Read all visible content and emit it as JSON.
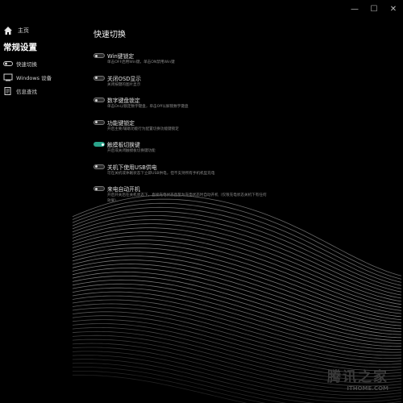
{
  "window": {
    "minimize_glyph": "—",
    "maximize_glyph": "☐",
    "close_glyph": "✕"
  },
  "sidebar": {
    "home_label": "主页",
    "section_title": "常规设置",
    "items": [
      {
        "label": "快速切换",
        "icon": "toggle-icon"
      },
      {
        "label": "Windows 设备",
        "icon": "windows-icon"
      },
      {
        "label": "信息查找",
        "icon": "info-icon"
      }
    ]
  },
  "main": {
    "title": "快速切换",
    "settings": [
      {
        "label": "Win键锁定",
        "desc": "单击OFF启用Win键，单击ON禁用Win键",
        "state": "off"
      },
      {
        "label": "关闭OSD显示",
        "desc": "关闭按键的图片显示",
        "state": "off"
      },
      {
        "label": "数字键盘锁定",
        "desc": "单击On以锁定数字键盘，单击Off以解锁数字键盘",
        "state": "off"
      },
      {
        "label": "功能键锁定",
        "desc": "开启主要/辅助功能行为配置切换功能键锁定",
        "state": "off"
      },
      {
        "label": "触摸板切换键",
        "desc": "开启或关闭触摸板切换键功能",
        "state": "on"
      },
      {
        "label": "关机下使用USB供电",
        "desc": "可在关机或休眠状态下立即USB供电，但不支持所有手机机型充电",
        "state": "off"
      },
      {
        "label": "来电自动开机",
        "desc": "开启开关后在关机状态下，直接充电状态直至为充电状态时自动开机（仅限充电状态关机下有任何效果）",
        "state": "off"
      }
    ]
  },
  "watermark": {
    "main": "腾讯之家",
    "sub": "ITHOME.COM"
  },
  "colors": {
    "background": "#000000",
    "accent": "#2aa38a"
  }
}
